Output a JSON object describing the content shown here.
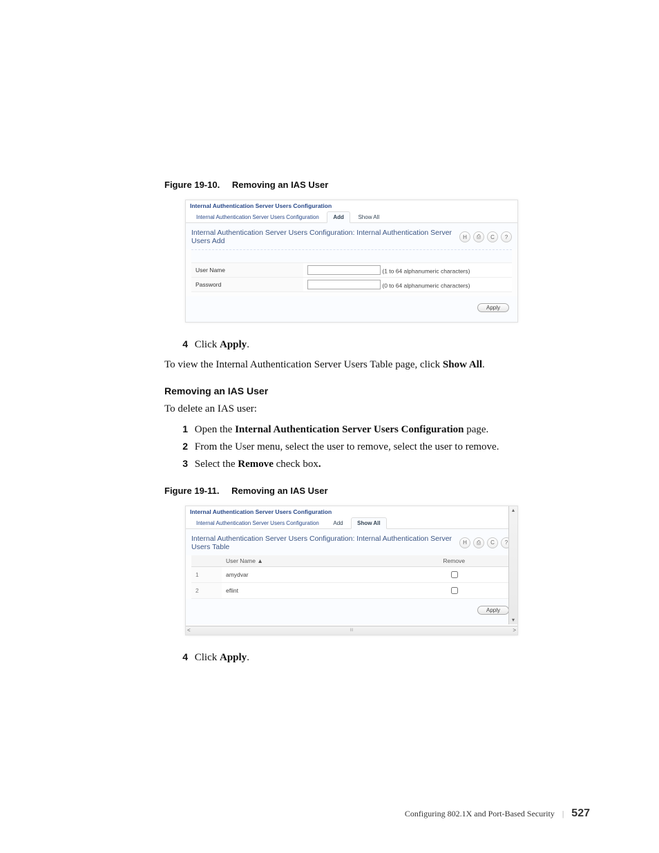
{
  "fig1": {
    "label": "Figure 19-10.",
    "title": "Removing an IAS User"
  },
  "fig2": {
    "label": "Figure 19-11.",
    "title": "Removing an IAS User"
  },
  "shot_common": {
    "breadcrumb": "Internal Authentication Server Users Configuration",
    "tab_main": "Internal Authentication Server Users Configuration",
    "tab_add": "Add",
    "tab_showall": "Show All",
    "apply": "Apply",
    "icons": {
      "save": "save-icon",
      "print": "print-icon",
      "refresh": "refresh-icon",
      "help": "help-icon"
    }
  },
  "shot1": {
    "panel_title": "Internal Authentication Server Users Configuration: Internal Authentication Server Users Add",
    "row1_label": "User Name",
    "row1_hint": "(1 to 64 alphanumeric characters)",
    "row2_label": "Password",
    "row2_hint": "(0 to 64 alphanumeric characters)"
  },
  "shot2": {
    "panel_title": "Internal Authentication Server Users Configuration: Internal Authentication Server Users Table",
    "col_user": "User Name",
    "col_remove": "Remove",
    "rows": [
      {
        "idx": "1",
        "name": "amydvar"
      },
      {
        "idx": "2",
        "name": "eflint"
      }
    ]
  },
  "prose": {
    "step4a": "Click ",
    "step4a_bold": "Apply",
    "step4a_tail": ".",
    "view_line_a": "To view the Internal Authentication Server Users Table page, click ",
    "view_line_bold": "Show All",
    "view_line_tail": ".",
    "subhead": "Removing an IAS User",
    "intro": "To delete an IAS user:",
    "s1a": "Open the ",
    "s1bold": "Internal Authentication Server Users Configuration",
    "s1tail": " page.",
    "s2": "From the User menu, select the user to remove, select the user to remove.",
    "s3a": "Select the ",
    "s3bold": "Remove",
    "s3tail": " check box",
    "s3dot": ".",
    "step4b": "Click ",
    "step4b_bold": "Apply",
    "step4b_tail": "."
  },
  "footer": {
    "chapter": "Configuring 802.1X and Port-Based Security",
    "page": "527"
  },
  "nums": {
    "n1": "1",
    "n2": "2",
    "n3": "3",
    "n4": "4"
  },
  "scroll": {
    "left": "<",
    "right": ">",
    "mid": "III"
  }
}
